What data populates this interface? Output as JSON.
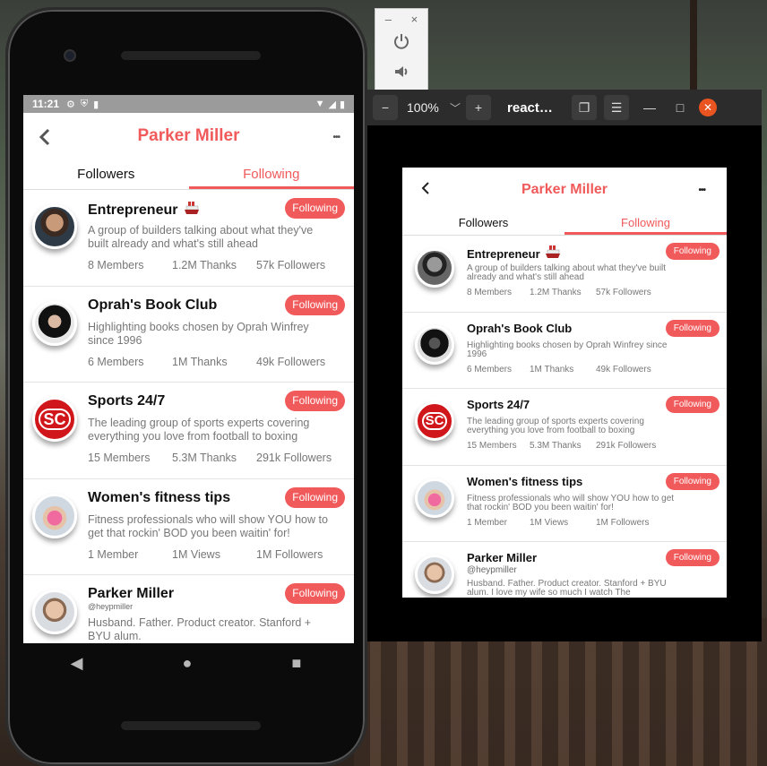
{
  "colors": {
    "accent": "#f05a5b",
    "statusbar": "#9b9b9b"
  },
  "status_bar": {
    "time": "11:21",
    "icons": [
      "gear-icon",
      "shield-icon",
      "sd-card-icon"
    ],
    "right_icons": [
      "wifi-icon",
      "signal-icon",
      "battery-icon"
    ]
  },
  "emulator_toolbar": {
    "minimize": "–",
    "close": "×",
    "buttons": [
      "power-icon",
      "volume-icon"
    ]
  },
  "app": {
    "title": "Parker Miller",
    "back_icon": "chevron-left-icon",
    "more_icon": "more-icon",
    "more_glyph": "•••",
    "tabs": [
      {
        "label": "Followers",
        "active": false
      },
      {
        "label": "Following",
        "active": true
      }
    ],
    "items": [
      {
        "name": "Entrepreneur",
        "emoji": "ship-icon",
        "desc": "A group of builders talking about what they've built already and what's still ahead",
        "stats": [
          "8 Members",
          "1.2M Thanks",
          "57k Followers"
        ],
        "button": "Following",
        "avatar": "man-beard"
      },
      {
        "name": "Oprah's Book Club",
        "desc": "Highlighting books chosen by Oprah Winfrey since 1996",
        "stats": [
          "6 Members",
          "1M Thanks",
          "49k Followers"
        ],
        "button": "Following",
        "avatar": "woman-curly"
      },
      {
        "name": "Sports 24/7",
        "desc": "The leading group of sports experts covering everything you love from football to boxing",
        "stats": [
          "15 Members",
          "5.3M Thanks",
          "291k Followers"
        ],
        "button": "Following",
        "avatar": "sc-logo"
      },
      {
        "name": "Women's fitness tips",
        "desc": "Fitness professionals who will show YOU how to get that rockin' BOD you been waitin' for!",
        "stats": [
          "1 Member",
          "1M Views",
          "1M Followers"
        ],
        "button": "Following",
        "avatar": "woman-fitness"
      },
      {
        "name": "Parker Miller",
        "handle": "@heypmiller",
        "desc": "Husband. Father. Product creator. Stanford + BYU alum.",
        "desc_right": "Husband. Father. Product creator. Stanford + BYU alum. I love my wife so much I watch The",
        "stats": [],
        "button": "Following",
        "avatar": "man-smiling"
      }
    ]
  },
  "nav_bar": {
    "back": "◀",
    "home": "●",
    "recents": "■"
  },
  "right_window": {
    "zoom_out_icon": "zoom-out-icon",
    "zoom_level": "100%",
    "zoom_dropdown": "﹀",
    "zoom_in_icon": "zoom-in-icon",
    "title": "react…",
    "controls": [
      "restore-icon",
      "menu-icon",
      "minimize-icon",
      "maximize-icon",
      "close-icon"
    ]
  }
}
